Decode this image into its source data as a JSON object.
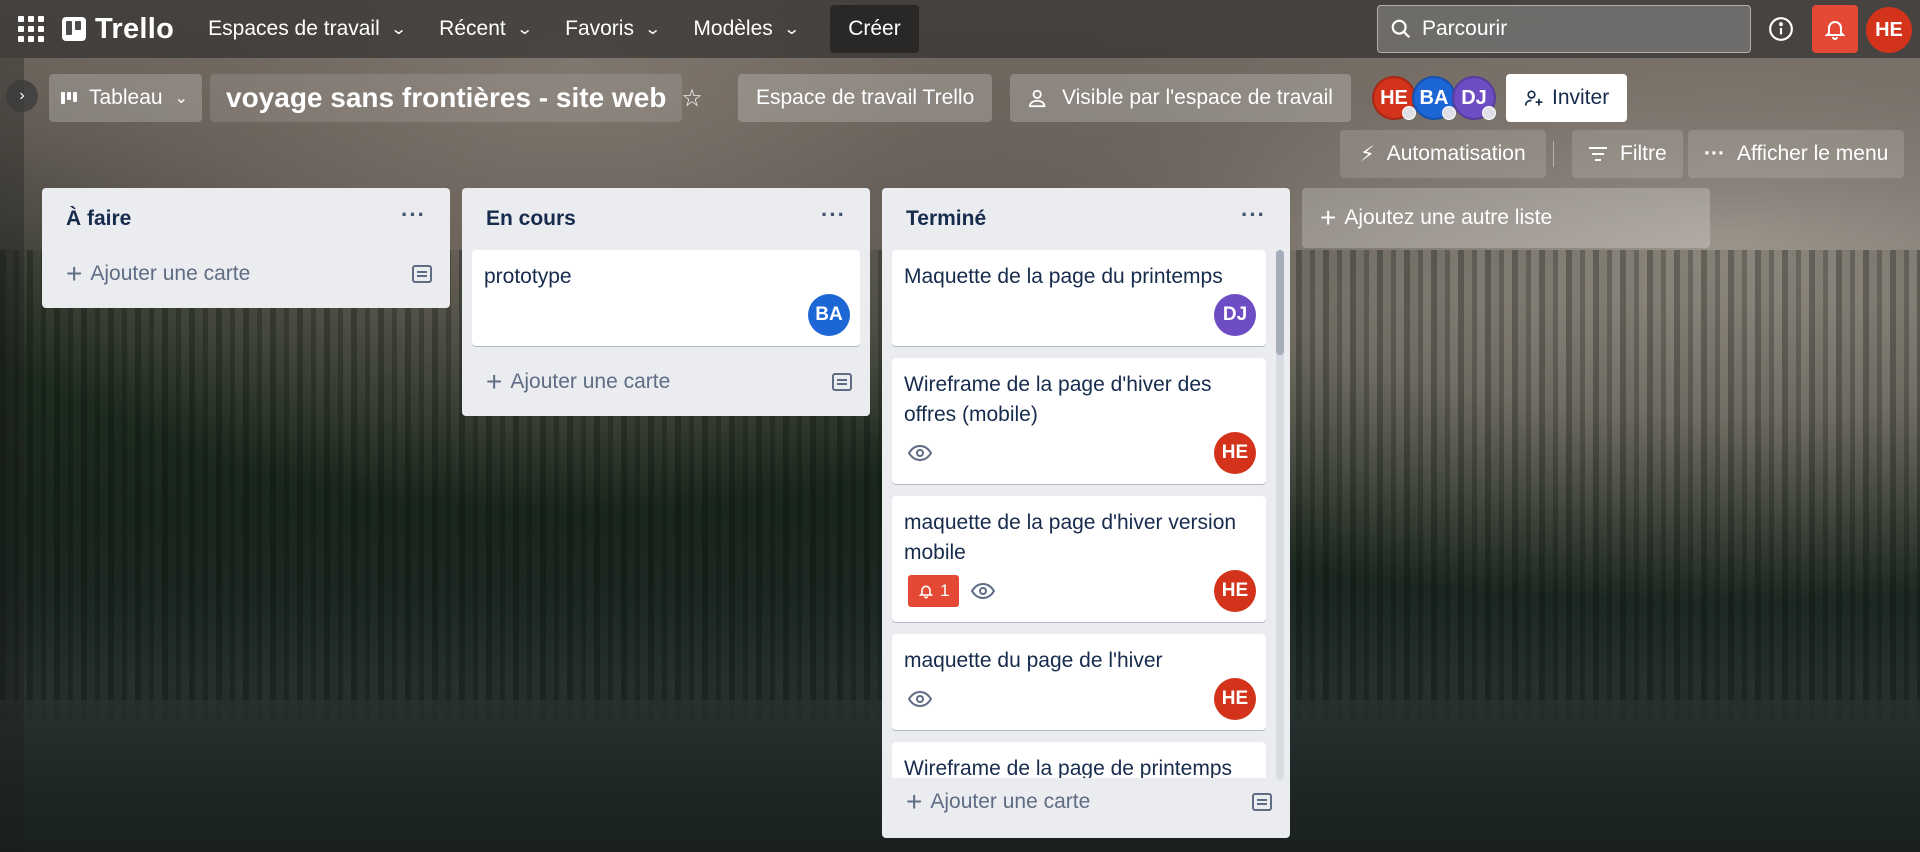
{
  "topnav": {
    "logo": "Trello",
    "items": [
      {
        "label": "Espaces de travail"
      },
      {
        "label": "Récent"
      },
      {
        "label": "Favoris"
      },
      {
        "label": "Modèles"
      }
    ],
    "create_label": "Créer",
    "search_placeholder": "Parcourir",
    "user_initials": "HE"
  },
  "board": {
    "view_label": "Tableau",
    "title": "voyage sans frontières - site web",
    "workspace_label": "Espace de travail Trello",
    "visibility_label": "Visible par l'espace de travail",
    "members": [
      {
        "initials": "HE",
        "color": "#d2331a"
      },
      {
        "initials": "BA",
        "color": "#1d66d6"
      },
      {
        "initials": "DJ",
        "color": "#6e4cc3"
      }
    ],
    "invite_label": "Inviter",
    "automation_label": "Automatisation",
    "filter_label": "Filtre",
    "menu_label": "Afficher le menu"
  },
  "lists": [
    {
      "title": "À faire",
      "add_card_label": "Ajouter une carte"
    },
    {
      "title": "En cours",
      "add_card_label": "Ajouter une carte",
      "cards": [
        {
          "title": "prototype",
          "member": "BA"
        }
      ]
    },
    {
      "title": "Terminé",
      "add_card_label": "Ajouter une carte",
      "cards": [
        {
          "title": "Maquette de la page du printemps",
          "member": "DJ"
        },
        {
          "title": "Wireframe de la page d'hiver des offres (mobile)",
          "member": "HE",
          "watching": true
        },
        {
          "title": "maquette de la page d'hiver version mobile",
          "member": "HE",
          "watching": true,
          "notifications": "1"
        },
        {
          "title": "maquette du page de l'hiver",
          "member": "HE",
          "watching": true
        },
        {
          "title": "Wireframe de la page de printemps"
        }
      ]
    }
  ],
  "add_list_label": "Ajoutez une autre liste",
  "colors": {
    "accent_red": "#e34935",
    "he": "#d2331a",
    "ba": "#1d66d6",
    "dj": "#6e4cc3"
  }
}
